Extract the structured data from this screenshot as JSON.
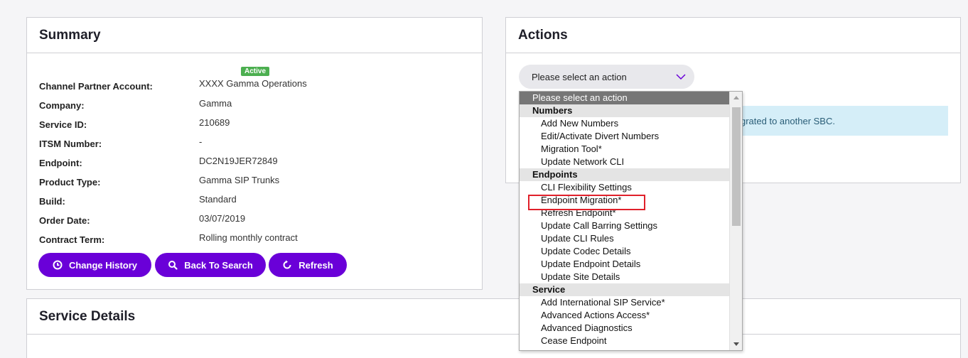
{
  "summary": {
    "title": "Summary",
    "status_badge": "Active",
    "fields": [
      {
        "label": "Channel Partner Account:",
        "value": "XXXX Gamma Operations"
      },
      {
        "label": "Company:",
        "value": "Gamma"
      },
      {
        "label": "Service ID:",
        "value": "210689"
      },
      {
        "label": "ITSM Number:",
        "value": "-"
      },
      {
        "label": "Endpoint:",
        "value": "DC2N19JER72849"
      },
      {
        "label": "Product Type:",
        "value": "Gamma SIP Trunks"
      },
      {
        "label": "Build:",
        "value": "Standard"
      },
      {
        "label": "Order Date:",
        "value": "03/07/2019"
      },
      {
        "label": "Contract Term:",
        "value": "Rolling monthly contract"
      }
    ],
    "buttons": {
      "change_history": "Change History",
      "back_to_search": "Back To Search",
      "refresh": "Refresh"
    }
  },
  "actions": {
    "title": "Actions",
    "select_value": "Please select an action",
    "info_text": "grated to another SBC."
  },
  "service_details": {
    "title": "Service Details"
  },
  "dropdown": {
    "items": [
      {
        "kind": "selected",
        "label": "Please select an action"
      },
      {
        "kind": "group",
        "label": "Numbers"
      },
      {
        "kind": "option",
        "label": "Add New Numbers"
      },
      {
        "kind": "option",
        "label": "Edit/Activate Divert Numbers"
      },
      {
        "kind": "option",
        "label": "Migration Tool*"
      },
      {
        "kind": "option",
        "label": "Update Network CLI"
      },
      {
        "kind": "group",
        "label": "Endpoints"
      },
      {
        "kind": "option",
        "label": "CLI Flexibility Settings"
      },
      {
        "kind": "option",
        "label": "Endpoint Migration*"
      },
      {
        "kind": "option",
        "label": "Refresh Endpoint*"
      },
      {
        "kind": "option",
        "label": "Update Call Barring Settings"
      },
      {
        "kind": "option",
        "label": "Update CLI Rules"
      },
      {
        "kind": "option",
        "label": "Update Codec Details"
      },
      {
        "kind": "option",
        "label": "Update Endpoint Details"
      },
      {
        "kind": "option",
        "label": "Update Site Details"
      },
      {
        "kind": "group",
        "label": "Service"
      },
      {
        "kind": "option",
        "label": "Add International SIP Service*"
      },
      {
        "kind": "option",
        "label": "Advanced Actions Access*"
      },
      {
        "kind": "option",
        "label": "Advanced Diagnostics"
      },
      {
        "kind": "option",
        "label": "Cease Endpoint"
      }
    ]
  },
  "colors": {
    "accent": "#6a00d8",
    "badge_green": "#4caf50",
    "highlight_red": "#e0202a",
    "info_bg": "#d5eef8"
  }
}
